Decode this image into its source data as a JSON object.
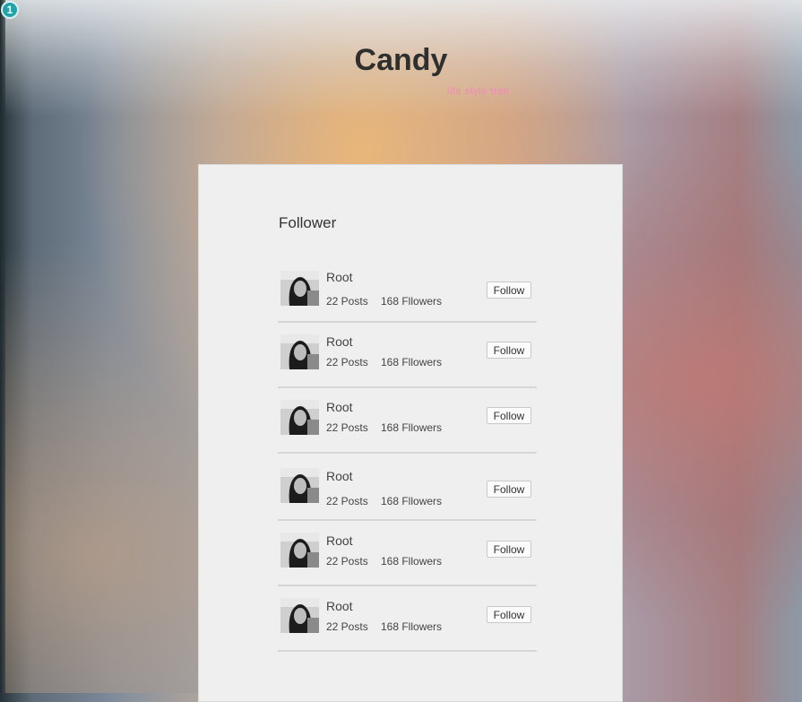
{
  "badge": {
    "number": "1"
  },
  "header": {
    "title": "Candy",
    "tagline": "life style tren"
  },
  "section": {
    "heading": "Follower",
    "items": [
      {
        "name": "Root",
        "posts": "22 Posts",
        "followers": "168 Fllowers",
        "button_label": "Follow"
      },
      {
        "name": "Root",
        "posts": "22 Posts",
        "followers": "168 Fllowers",
        "button_label": "Follow"
      },
      {
        "name": "Root",
        "posts": "22 Posts",
        "followers": "168 Fllowers",
        "button_label": "Follow"
      },
      {
        "name": "Root",
        "posts": "22 Posts",
        "followers": "168 Fllowers",
        "button_label": "Follow"
      },
      {
        "name": "Root",
        "posts": "22 Posts",
        "followers": "168 Fllowers",
        "button_label": "Follow"
      },
      {
        "name": "Root",
        "posts": "22 Posts",
        "followers": "168 Fllowers",
        "button_label": "Follow"
      }
    ]
  }
}
